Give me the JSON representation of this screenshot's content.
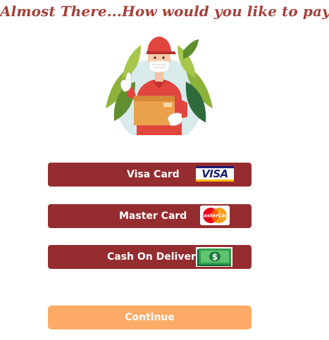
{
  "header": {
    "title": "Almost There...How would you like to pay?"
  },
  "illustration": {
    "icon": "delivery-person-with-package"
  },
  "payment_options": [
    {
      "label": "Visa Card",
      "icon": "visa-logo",
      "logo_text": "VISA"
    },
    {
      "label": "Master Card",
      "icon": "mastercard-logo",
      "logo_text": "MasterCard"
    },
    {
      "label": "Cash On Delivery",
      "icon": "cash-bill-icon",
      "logo_text": "$"
    }
  ],
  "continue": {
    "label": "Continue"
  },
  "colors": {
    "title": "#a6403a",
    "payment_button": "#952d30",
    "continue_button": "#fdab67"
  }
}
